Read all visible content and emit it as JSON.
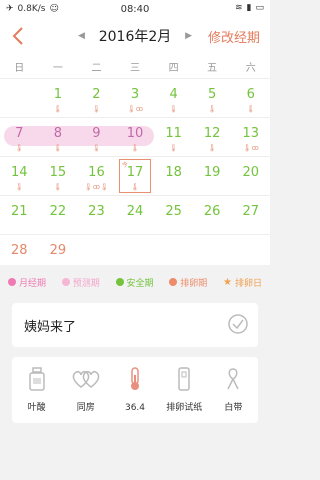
{
  "status": {
    "speed": "0.8K/s",
    "time": "08:40"
  },
  "header": {
    "month_title": "2016年2月",
    "edit_label": "修改经期"
  },
  "weekdays": [
    "日",
    "一",
    "二",
    "三",
    "四",
    "五",
    "六"
  ],
  "days": {
    "d1": "1",
    "d2": "2",
    "d3": "3",
    "d4": "4",
    "d5": "5",
    "d6": "6",
    "d7": "7",
    "d8": "8",
    "d9": "9",
    "d10": "10",
    "d11": "11",
    "d12": "12",
    "d13": "13",
    "d14": "14",
    "d15": "15",
    "d16": "16",
    "d17": "17",
    "d18": "18",
    "d19": "19",
    "d20": "20",
    "d21": "21",
    "d22": "22",
    "d23": "23",
    "d24": "24",
    "d25": "25",
    "d26": "26",
    "d27": "27",
    "d28": "28",
    "d29": "29"
  },
  "today_tag": "今",
  "legend": {
    "period": "月经期",
    "predicted": "预测期",
    "safe": "安全期",
    "ovulation": "排卵期",
    "ovulation_day": "排卵日"
  },
  "colors": {
    "period": "#f07ab2",
    "predicted": "#f6b6d6",
    "safe": "#74c33c",
    "ovulation": "#ee8b6a",
    "ovulation_day": "#f0a050"
  },
  "period_card": {
    "text": "姨妈来了"
  },
  "tools": {
    "folic": "叶酸",
    "intimacy": "同房",
    "temp": "36.4",
    "test": "排卵试纸",
    "discharge": "白带"
  }
}
